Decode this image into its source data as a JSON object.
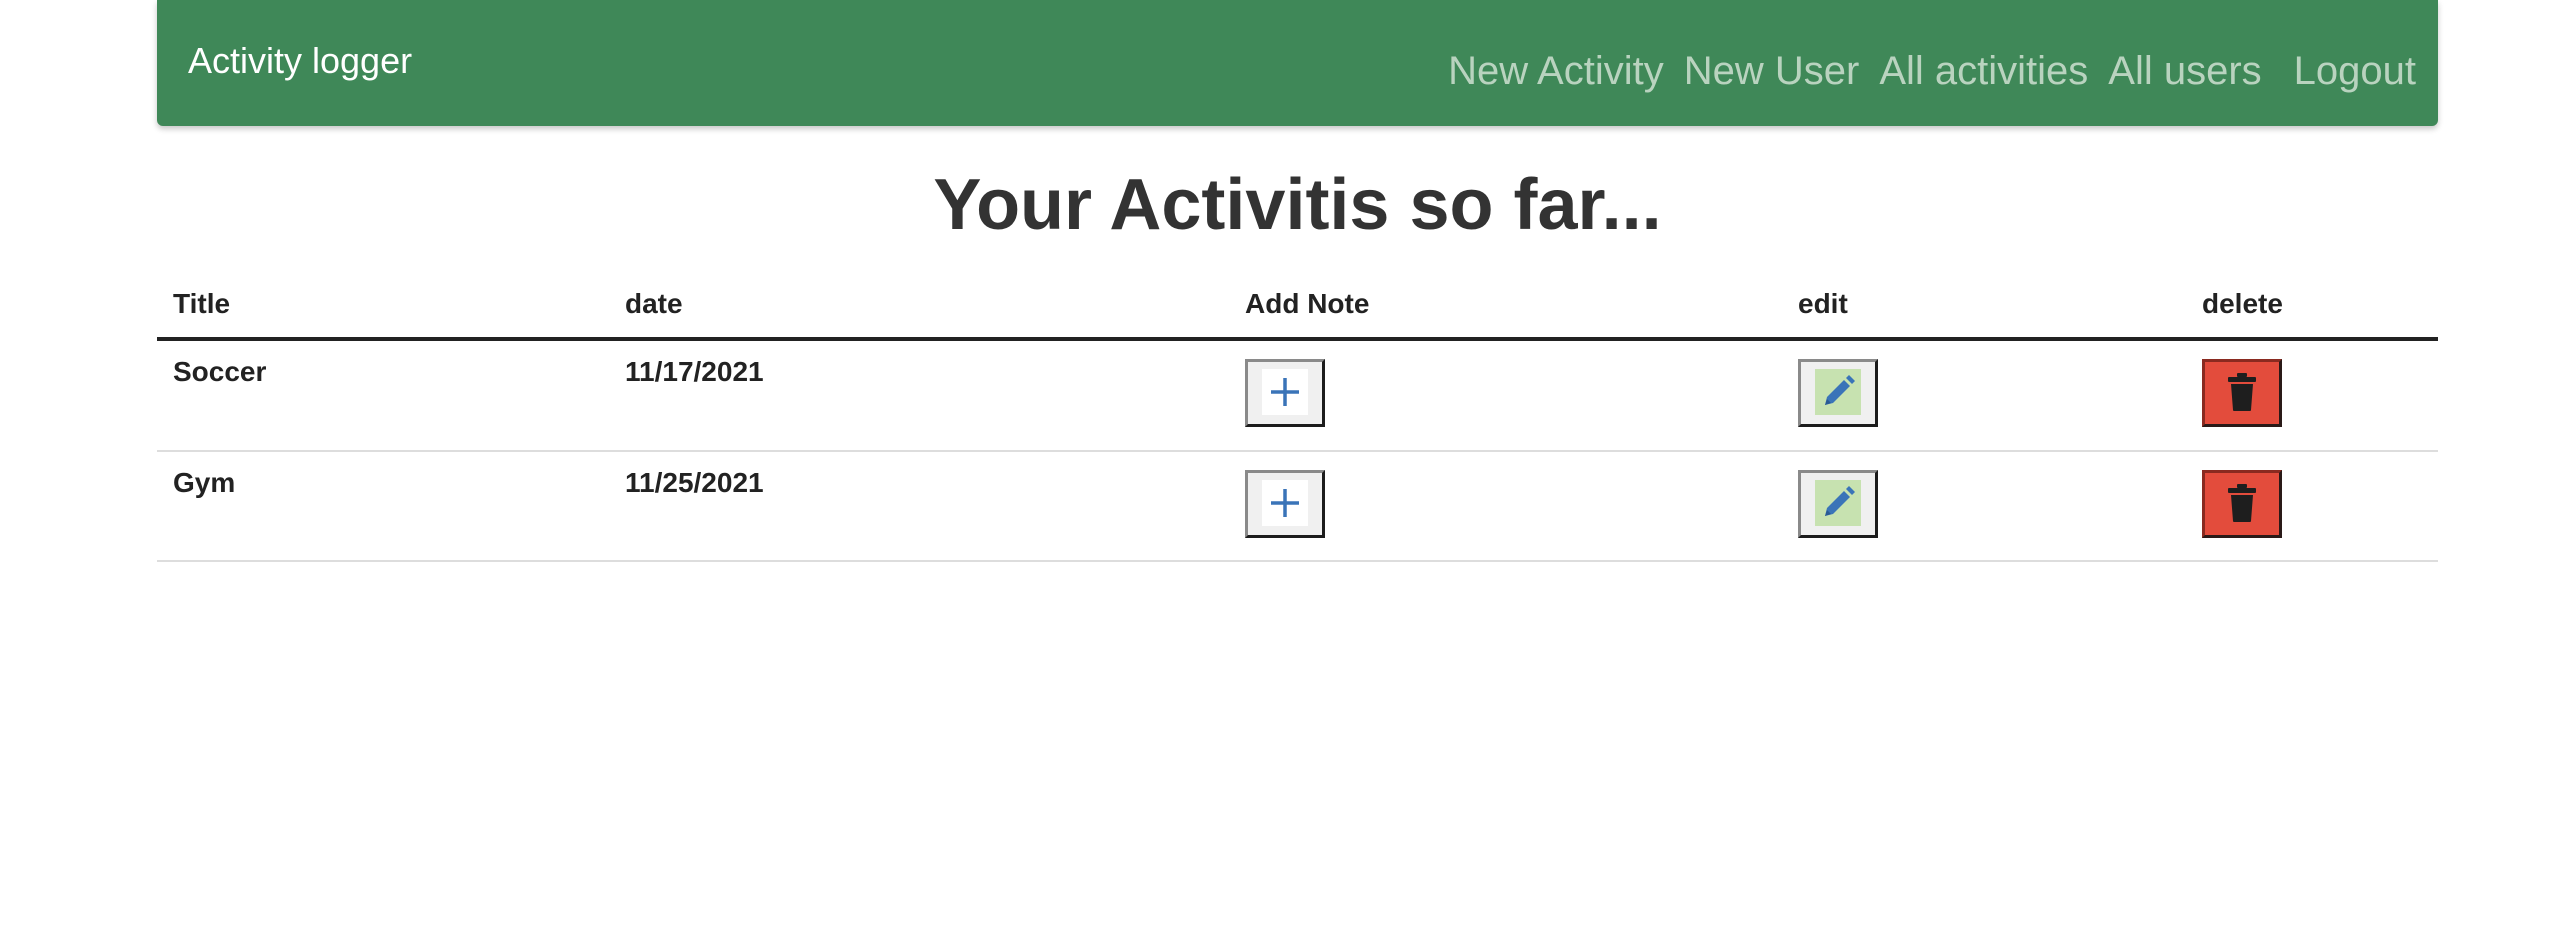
{
  "nav": {
    "brand": "Activity logger",
    "links": [
      "New Activity",
      "New User",
      "All activities",
      "All users",
      "Logout"
    ]
  },
  "page": {
    "title": "Your Activitis so far..."
  },
  "table": {
    "headers": [
      "Title",
      "date",
      "Add Note",
      "edit",
      "delete"
    ],
    "rows": [
      {
        "title": "Soccer",
        "date": "11/17/2021"
      },
      {
        "title": "Gym",
        "date": "11/25/2021"
      }
    ]
  },
  "icons": {
    "add_note": "plus-icon",
    "edit": "pencil-icon",
    "delete": "trash-icon"
  },
  "colors": {
    "navbar": "#3f8858",
    "nav_link": "#b9d3bf",
    "delete_button": "#e34c3c",
    "edit_icon_bg": "#c7e2b0",
    "icon_blue": "#3a74b8"
  }
}
